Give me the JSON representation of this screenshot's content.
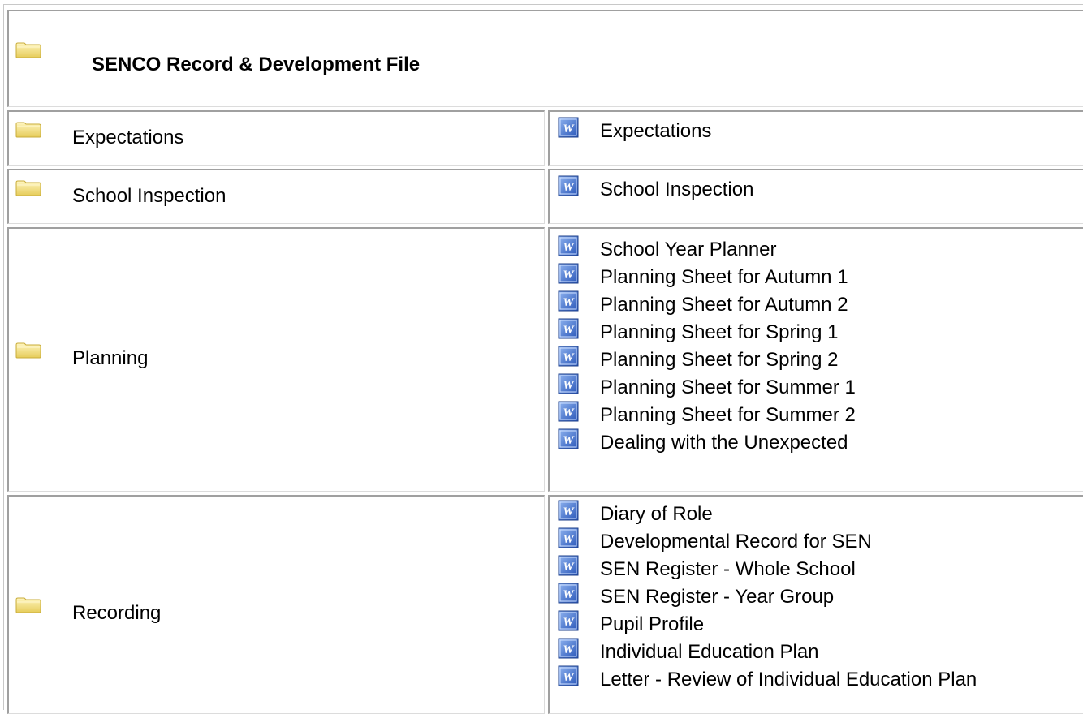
{
  "title": "SENCO Record &  Development File",
  "rows": [
    {
      "folder_label": "Expectations",
      "documents": [
        "Expectations"
      ]
    },
    {
      "folder_label": "School Inspection",
      "documents": [
        "School Inspection"
      ]
    },
    {
      "folder_label": "Planning",
      "documents": [
        "School Year Planner",
        "Planning Sheet for Autumn 1",
        "Planning Sheet for Autumn 2",
        "Planning Sheet for Spring 1",
        "Planning Sheet for Spring 2",
        "Planning Sheet for Summer 1",
        "Planning Sheet for Summer 2",
        "Dealing with the Unexpected"
      ]
    },
    {
      "folder_label": "Recording",
      "documents": [
        "Diary of Role",
        "Developmental Record for SEN",
        "SEN Register - Whole School",
        "SEN Register - Year Group",
        "Pupil Profile",
        "Individual Education Plan",
        "Letter - Review of Individual Education Plan"
      ]
    }
  ],
  "icons": {
    "folder": "folder-icon",
    "document": "word-document-icon"
  },
  "colors": {
    "folder": "#f0dc78",
    "word_icon": "#3a68c8"
  }
}
